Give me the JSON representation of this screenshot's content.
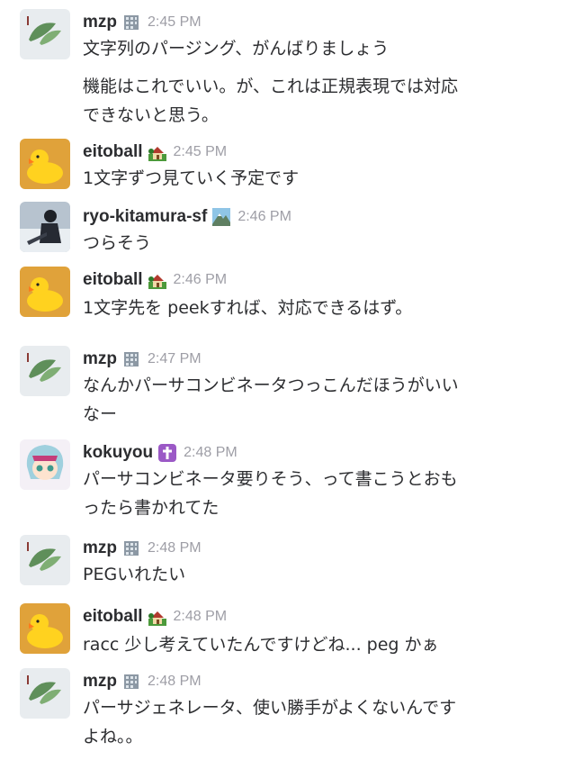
{
  "messages": [
    {
      "user": "mzp",
      "time": "2:45 PM",
      "lines": [
        "文字列のパージング、がんばりましょう",
        "機能はこれでいい。が、これは正規表現では対応",
        "できないと思う。"
      ]
    },
    {
      "user": "eitoball",
      "time": "2:45 PM",
      "lines": [
        "1文字ずつ見ていく予定です"
      ]
    },
    {
      "user": "ryo-kitamura-sf",
      "time": "2:46 PM",
      "lines": [
        "つらそう"
      ]
    },
    {
      "user": "eitoball",
      "time": "2:46 PM",
      "lines": [
        "1文字先を peekすれば、対応できるはず。"
      ]
    },
    {
      "user": "mzp",
      "time": "2:47 PM",
      "lines": [
        "なんかパーサコンビネータつっこんだほうがいい",
        "なー"
      ]
    },
    {
      "user": "kokuyou",
      "time": "2:48 PM",
      "lines": [
        "パーサコンビネータ要りそう、って書こうとおも",
        "ったら書かれてた"
      ]
    },
    {
      "user": "mzp",
      "time": "2:48 PM",
      "lines": [
        "PEGいれたい"
      ]
    },
    {
      "user": "eitoball",
      "time": "2:48 PM",
      "lines": [
        "racc 少し考えていたんですけどね... peg かぁ"
      ]
    },
    {
      "user": "mzp",
      "time": "2:48 PM",
      "lines": [
        "パーサジェネレータ、使い勝手がよくないんです",
        "よね。。"
      ]
    }
  ]
}
